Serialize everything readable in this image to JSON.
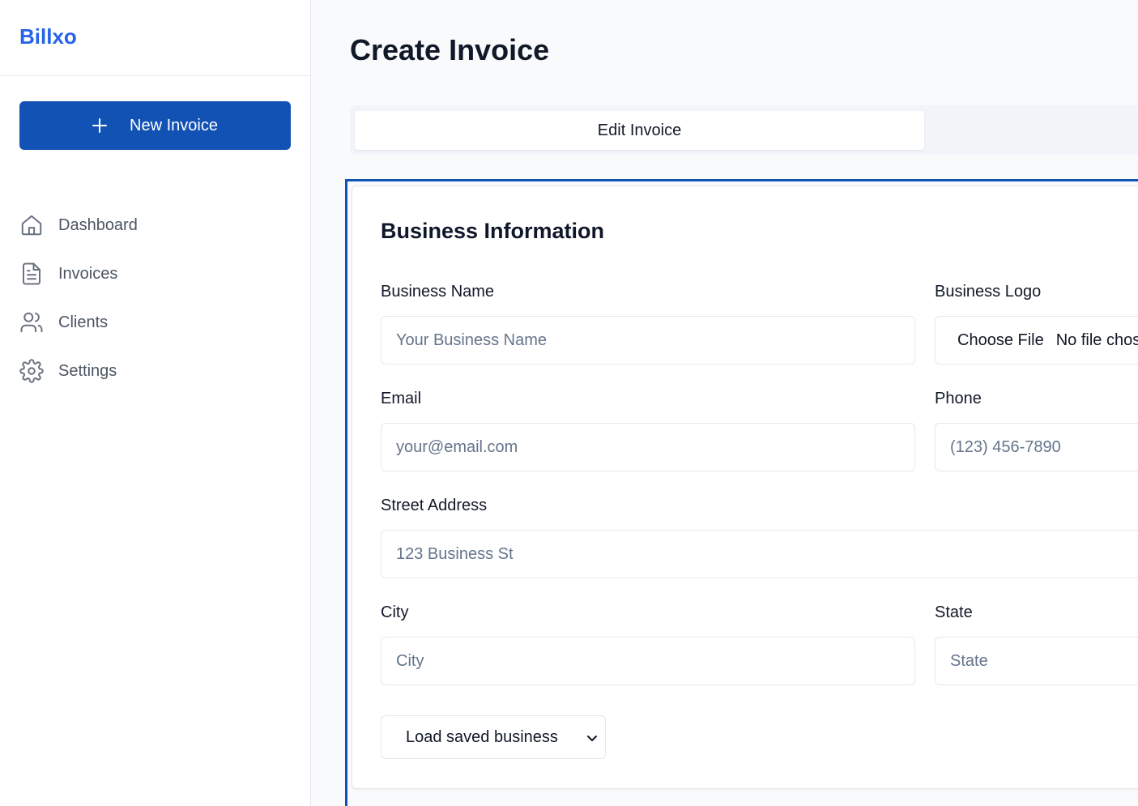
{
  "brand": {
    "name": "Billxo",
    "color": "#2563eb"
  },
  "sidebar": {
    "new_button": {
      "label": "New Invoice",
      "icon": "plus-icon"
    },
    "items": [
      {
        "label": "Dashboard",
        "icon": "home-icon"
      },
      {
        "label": "Invoices",
        "icon": "file-text-icon"
      },
      {
        "label": "Clients",
        "icon": "users-icon"
      },
      {
        "label": "Settings",
        "icon": "gear-icon"
      }
    ]
  },
  "page": {
    "title": "Create Invoice"
  },
  "tabs": [
    {
      "label": "Edit Invoice",
      "active": true
    }
  ],
  "business_section": {
    "title": "Business Information",
    "fields": {
      "business_name": {
        "label": "Business Name",
        "placeholder": "Your Business Name"
      },
      "business_logo": {
        "label": "Business Logo",
        "button": "Choose File",
        "status": "No file chosen"
      },
      "email": {
        "label": "Email",
        "placeholder": "your@email.com"
      },
      "phone": {
        "label": "Phone",
        "placeholder": "(123) 456-7890"
      },
      "street": {
        "label": "Street Address",
        "placeholder": "123 Business St"
      },
      "city": {
        "label": "City",
        "placeholder": "City"
      },
      "state": {
        "label": "State",
        "placeholder": "State"
      }
    },
    "saved_select": {
      "selected": "Load saved business"
    }
  },
  "colors": {
    "primary": "#1252b4",
    "text_muted": "#4b5563",
    "placeholder": "#64748b"
  }
}
